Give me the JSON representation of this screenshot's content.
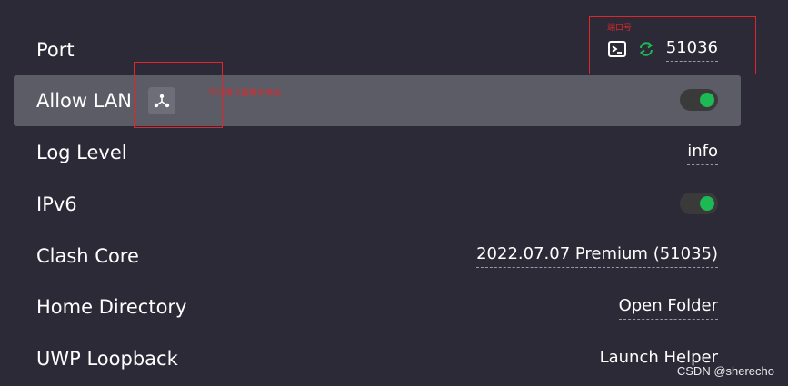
{
  "settings": {
    "port": {
      "label": "Port",
      "value": "51036"
    },
    "allow_lan": {
      "label": "Allow LAN",
      "enabled": true
    },
    "log_level": {
      "label": "Log Level",
      "value": "info"
    },
    "ipv6": {
      "label": "IPv6",
      "enabled": true
    },
    "clash_core": {
      "label": "Clash Core",
      "value": "2022.07.07 Premium (51035)"
    },
    "home_directory": {
      "label": "Home Directory",
      "value": "Open Folder"
    },
    "uwp_loopback": {
      "label": "UWP Loopback",
      "value": "Launch Helper"
    }
  },
  "icons": {
    "terminal": "terminal-icon",
    "refresh": "refresh-icon",
    "network": "network-icon"
  },
  "annotations": {
    "port_note": "端口号",
    "lan_note": "可以用以查看IP地址"
  },
  "colors": {
    "background": "#2c2a37",
    "highlight_row": "#5c5c66",
    "accent_green": "#1db954",
    "annotation_red": "#e0262a"
  },
  "watermark": "CSDN @sherecho"
}
